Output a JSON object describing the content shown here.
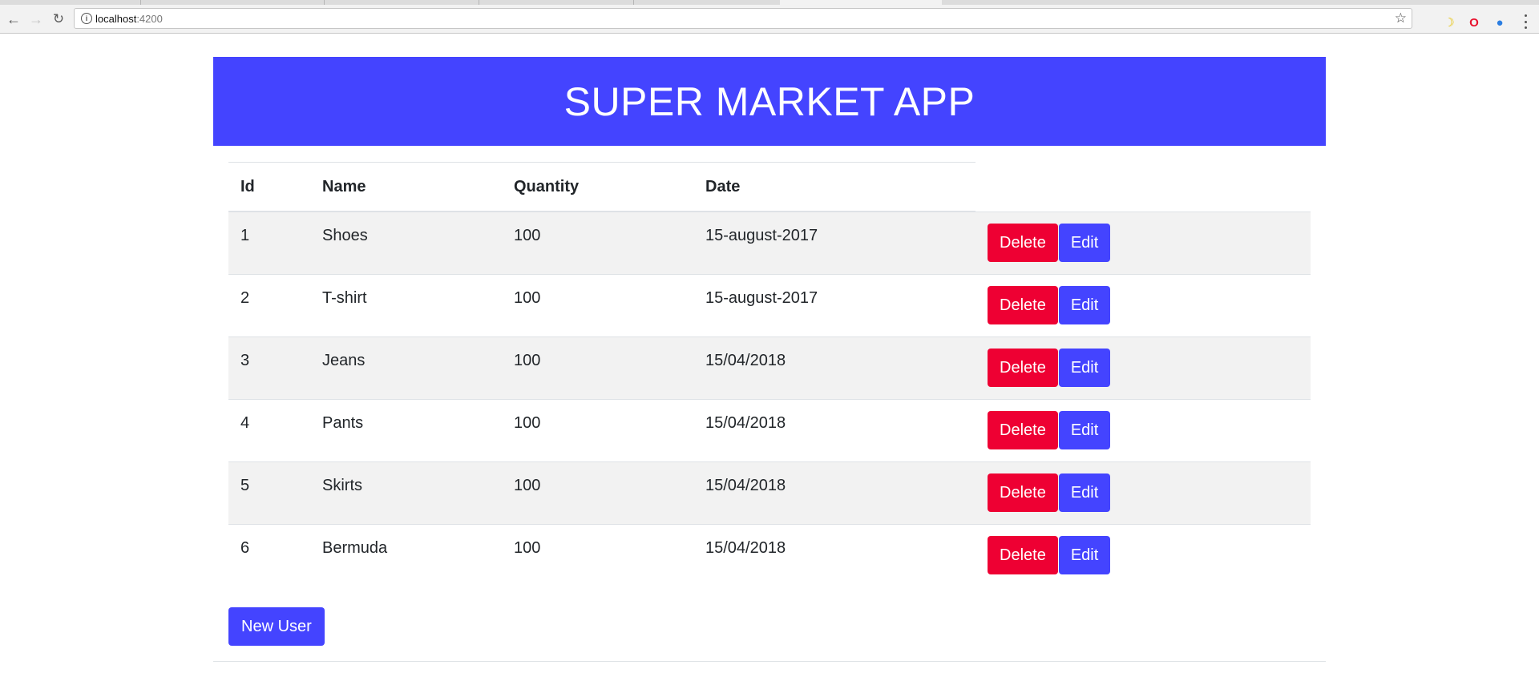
{
  "browser": {
    "url_host": "localhost",
    "url_port": ":4200",
    "back_icon": "arrow-left-icon",
    "forward_icon": "arrow-right-icon",
    "reload_icon": "reload-icon",
    "bookmark_icon": "star-icon"
  },
  "header": {
    "title": "SUPER MARKET APP",
    "background_color": "#4444ff"
  },
  "table": {
    "columns": [
      "Id",
      "Name",
      "Quantity",
      "Date"
    ],
    "rows": [
      {
        "id": "1",
        "name": "Shoes",
        "quantity": "100",
        "date": "15-august-2017"
      },
      {
        "id": "2",
        "name": "T-shirt",
        "quantity": "100",
        "date": "15-august-2017"
      },
      {
        "id": "3",
        "name": "Jeans",
        "quantity": "100",
        "date": "15/04/2018"
      },
      {
        "id": "4",
        "name": "Pants",
        "quantity": "100",
        "date": "15/04/2018"
      },
      {
        "id": "5",
        "name": "Skirts",
        "quantity": "100",
        "date": "15/04/2018"
      },
      {
        "id": "6",
        "name": "Bermuda",
        "quantity": "100",
        "date": "15/04/2018"
      }
    ],
    "delete_label": "Delete",
    "edit_label": "Edit"
  },
  "actions": {
    "new_user_label": "New User"
  },
  "colors": {
    "delete_button": "#ee0033",
    "primary_button": "#4444ff",
    "stripe": "#f2f2f2"
  }
}
